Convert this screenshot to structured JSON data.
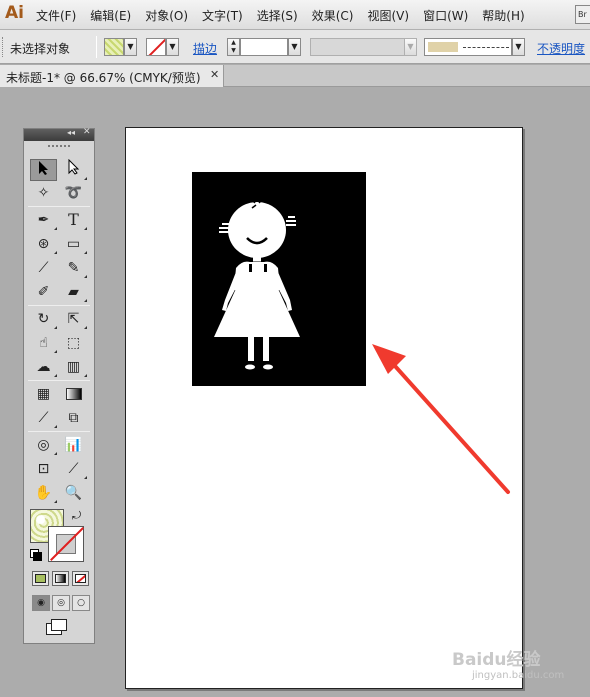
{
  "app": {
    "logo": "Ai"
  },
  "menu": {
    "items": [
      "文件(F)",
      "编辑(E)",
      "对象(O)",
      "文字(T)",
      "选择(S)",
      "效果(C)",
      "视图(V)",
      "窗口(W)",
      "帮助(H)"
    ],
    "bridge": "Br"
  },
  "control_bar": {
    "selection_status": "未选择对象",
    "stroke_label": "描边",
    "opacity_label": "不透明度"
  },
  "document": {
    "tab_title": "未标题-1* @ 66.67% (CMYK/预览)",
    "tab_close": "✕"
  },
  "tools_panel": {
    "collapse": "◂◂",
    "close": "✕",
    "tools": [
      "selection-tool",
      "direct-selection-tool",
      "magic-wand-tool",
      "lasso-tool",
      "pen-tool",
      "type-tool",
      "spiral-tool",
      "rectangle-tool",
      "paintbrush-tool",
      "pencil-tool",
      "blob-brush-tool",
      "eraser-tool",
      "rotate-tool",
      "scale-tool",
      "warp-tool",
      "free-transform-tool",
      "symbol-sprayer-tool",
      "column-graph-tool",
      "mesh-tool",
      "gradient-tool",
      "eyedropper-tool",
      "blend-tool",
      "live-paint-bucket-tool",
      "live-paint-selection-tool",
      "artboard-tool",
      "slice-tool",
      "hand-tool",
      "zoom-tool"
    ]
  },
  "colors": {
    "accent_arrow": "#f03a2e",
    "logo": "#a35a1b",
    "link": "#1a56c2"
  },
  "watermark": {
    "text": "Baidu经验",
    "sub": "jingyan.baidu.com"
  }
}
